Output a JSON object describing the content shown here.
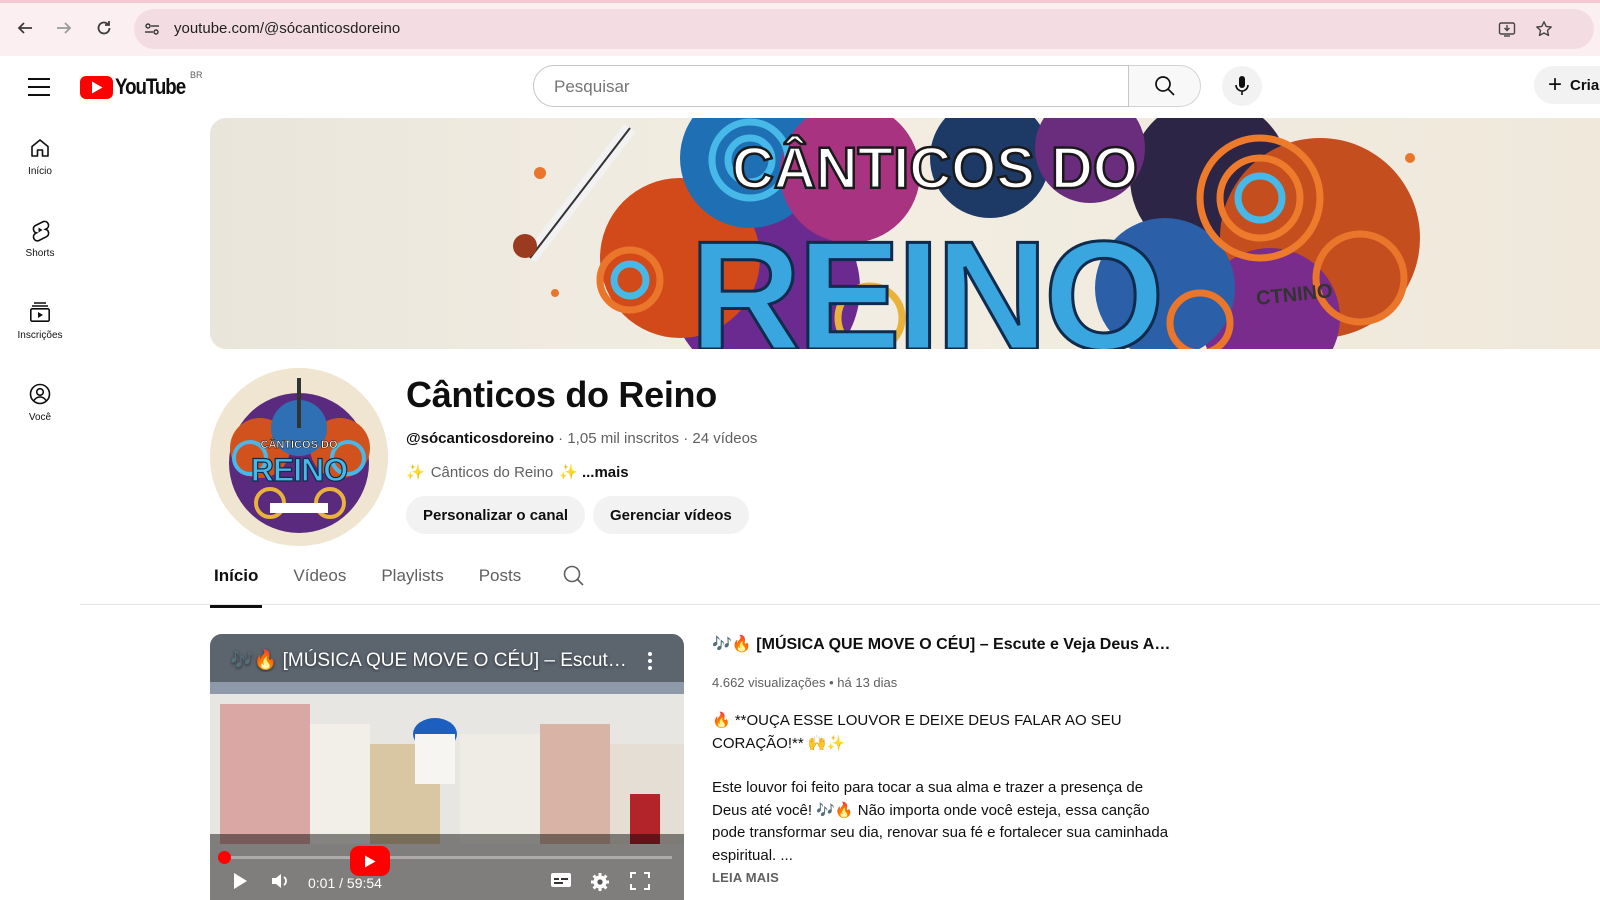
{
  "browser": {
    "url": "youtube.com/@sócanticosdoreino"
  },
  "masthead": {
    "logo_text": "YouTube",
    "region": "BR",
    "search_placeholder": "Pesquisar",
    "create_label": "Criar"
  },
  "guide": {
    "items": [
      {
        "label": "Início",
        "icon": "home-icon"
      },
      {
        "label": "Shorts",
        "icon": "shorts-icon"
      },
      {
        "label": "Inscrições",
        "icon": "subscriptions-icon"
      },
      {
        "label": "Você",
        "icon": "you-icon"
      }
    ]
  },
  "banner": {
    "line1": "CÂNTICOS DO",
    "line2": "REINO",
    "small": "CTNINO"
  },
  "avatar": {
    "line1": "CÂNTICOS DO",
    "line2": "REINO"
  },
  "channel": {
    "title": "Cânticos do Reino",
    "handle": "@sócanticosdoreino",
    "subscribers": "1,05 mil inscritos",
    "videos": "24 vídeos",
    "separator": "·",
    "description": "Cânticos do Reino",
    "more": "...mais",
    "customize_label": "Personalizar o canal",
    "manage_label": "Gerenciar vídeos"
  },
  "tabs": [
    "Início",
    "Vídeos",
    "Playlists",
    "Posts"
  ],
  "featured": {
    "player_title": "🎶🔥 [MÚSICA QUE MOVE O CÉU] – Escute e Veja Deus Agindo",
    "time": "0:01 / 59:54",
    "title": "🎶🔥 [MÚSICA QUE MOVE O CÉU] – Escute e Veja Deus Agindo",
    "views": "4.662 visualizações",
    "age": "há 13 dias",
    "desc_p1": "🔥 **OUÇA ESSE LOUVOR E DEIXE DEUS FALAR AO SEU CORAÇÃO!** 🙌✨",
    "desc_p2": "Este louvor foi feito para tocar a sua alma e trazer a presença de Deus até você! 🎶🔥 Não importa onde você esteja, essa canção pode transformar seu dia, renovar sua fé e fortalecer sua caminhada espiritual.  ...",
    "read_more": "LEIA MAIS"
  },
  "colors": {
    "brand_red": "#ff0000",
    "chrome_bg": "#fbeff2",
    "omnibox_bg": "#f3dde3",
    "text_secondary": "#606060"
  }
}
